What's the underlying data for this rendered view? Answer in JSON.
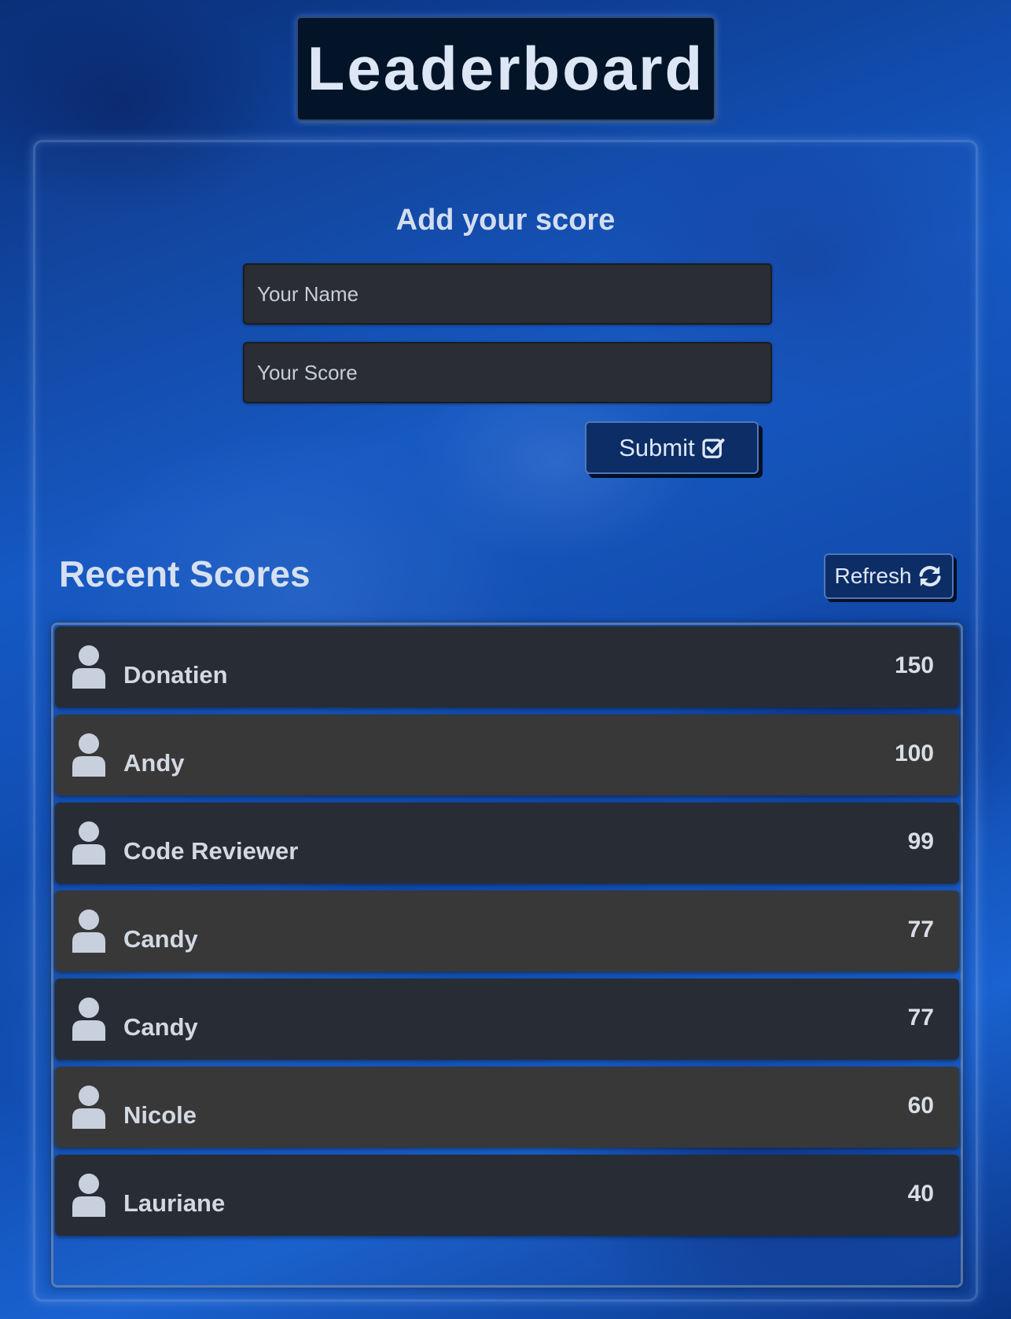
{
  "header": {
    "title": "Leaderboard"
  },
  "form": {
    "title": "Add your score",
    "name_placeholder": "Your Name",
    "score_placeholder": "Your Score",
    "submit_label": "Submit",
    "submit_icon": "check-square-icon"
  },
  "scores": {
    "title": "Recent Scores",
    "refresh_label": "Refresh",
    "refresh_icon": "sync-icon",
    "entries": [
      {
        "name": "Donatien",
        "score": "150"
      },
      {
        "name": "Andy",
        "score": "100"
      },
      {
        "name": "Code Reviewer",
        "score": "99"
      },
      {
        "name": "Candy",
        "score": "77"
      },
      {
        "name": "Candy",
        "score": "77"
      },
      {
        "name": "Nicole",
        "score": "60"
      },
      {
        "name": "Lauriane",
        "score": "40"
      }
    ]
  },
  "colors": {
    "background": "#0d4aa3",
    "title_box": "#031428",
    "button": "#0c2d66",
    "row_dark": "#282c34",
    "row_grey": "#383838",
    "text": "#d3d9e2"
  }
}
